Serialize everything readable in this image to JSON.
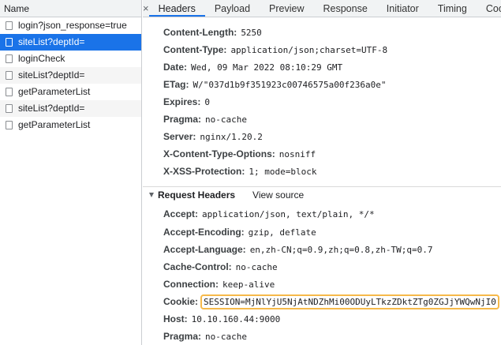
{
  "request_list": {
    "header": "Name",
    "items": [
      {
        "label": "login?json_response=true"
      },
      {
        "label": "siteList?deptId="
      },
      {
        "label": "loginCheck"
      },
      {
        "label": "siteList?deptId="
      },
      {
        "label": "getParameterList"
      },
      {
        "label": "siteList?deptId="
      },
      {
        "label": "getParameterList"
      }
    ],
    "selected_index": 1
  },
  "tabs": {
    "close_glyph": "×",
    "items": [
      {
        "label": "Headers"
      },
      {
        "label": "Payload"
      },
      {
        "label": "Preview"
      },
      {
        "label": "Response"
      },
      {
        "label": "Initiator"
      },
      {
        "label": "Timing"
      },
      {
        "label": "Cookies"
      }
    ],
    "active": "Headers"
  },
  "response_headers": [
    {
      "name": "Content-Length:",
      "value": "5250"
    },
    {
      "name": "Content-Type:",
      "value": "application/json;charset=UTF-8"
    },
    {
      "name": "Date:",
      "value": "Wed, 09 Mar 2022 08:10:29 GMT"
    },
    {
      "name": "ETag:",
      "value": "W/\"037d1b9f351923c00746575a00f236a0e\""
    },
    {
      "name": "Expires:",
      "value": "0"
    },
    {
      "name": "Pragma:",
      "value": "no-cache"
    },
    {
      "name": "Server:",
      "value": "nginx/1.20.2"
    },
    {
      "name": "X-Content-Type-Options:",
      "value": "nosniff"
    },
    {
      "name": "X-XSS-Protection:",
      "value": "1; mode=block"
    }
  ],
  "request_section": {
    "title": "Request Headers",
    "view_source": "View source"
  },
  "request_headers": [
    {
      "name": "Accept:",
      "value": "application/json, text/plain, */*"
    },
    {
      "name": "Accept-Encoding:",
      "value": "gzip, deflate"
    },
    {
      "name": "Accept-Language:",
      "value": "en,zh-CN;q=0.9,zh;q=0.8,zh-TW;q=0.7"
    },
    {
      "name": "Cache-Control:",
      "value": "no-cache"
    },
    {
      "name": "Connection:",
      "value": "keep-alive"
    },
    {
      "name": "Cookie:",
      "value": "SESSION=MjNlYjU5NjAtNDZhMi00ODUyLTkzZDktZTg0ZGJjYWQwNjI0",
      "highlighted": true
    },
    {
      "name": "Host:",
      "value": "10.10.160.44:9000"
    },
    {
      "name": "Pragma:",
      "value": "no-cache"
    }
  ],
  "colors": {
    "selection": "#1a73e8",
    "cookie_highlight_border": "#f6b94a"
  }
}
